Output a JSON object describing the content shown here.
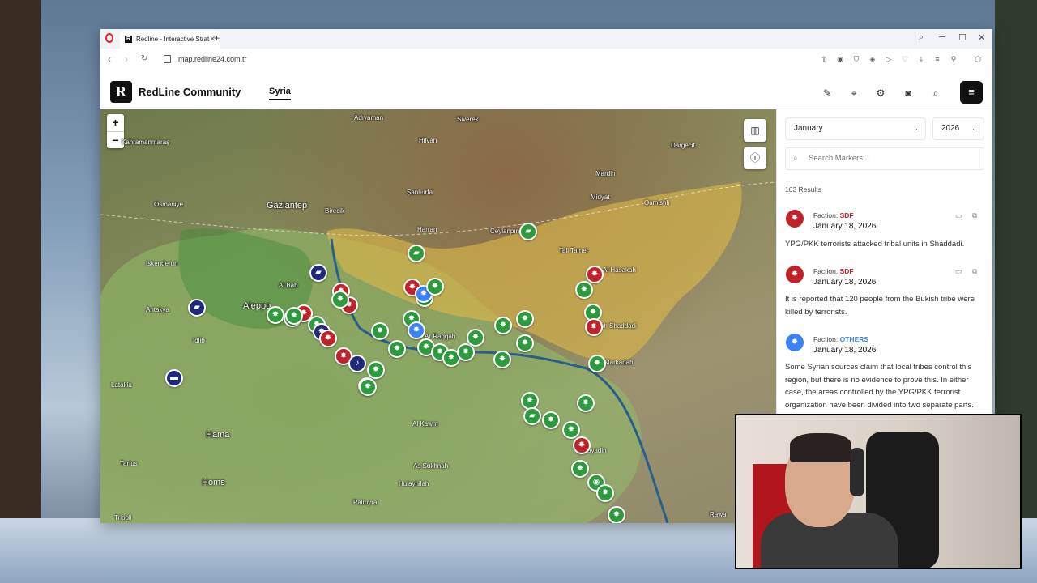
{
  "browser": {
    "tab_title": "Redline - Interactive Strat",
    "new_tab": "+",
    "url": "map.redline24.com.tr"
  },
  "header": {
    "logo": "R",
    "brand": "RedLine Community",
    "nav_tab": "Syria"
  },
  "map": {
    "zoom_in": "+",
    "zoom_out": "−",
    "cities": [
      {
        "name": "Adıyaman",
        "big": false
      },
      {
        "name": "Kahramanmaraş",
        "big": false
      },
      {
        "name": "Gaziantep",
        "big": true
      },
      {
        "name": "Şanlıurfa",
        "big": false
      },
      {
        "name": "Mardin",
        "big": false
      },
      {
        "name": "Osmaniye",
        "big": false
      },
      {
        "name": "Iskenderun",
        "big": false
      },
      {
        "name": "Antakya",
        "big": false
      },
      {
        "name": "Aleppo",
        "big": true
      },
      {
        "name": "Al Bab",
        "big": false
      },
      {
        "name": "Latakia",
        "big": false
      },
      {
        "name": "Hama",
        "big": true
      },
      {
        "name": "Homs",
        "big": true
      },
      {
        "name": "Tartus",
        "big": false
      },
      {
        "name": "Tripoli",
        "big": false
      },
      {
        "name": "Palmyra",
        "big": false
      },
      {
        "name": "Ar Raqqah",
        "big": false
      },
      {
        "name": "Harran",
        "big": false
      },
      {
        "name": "Ceylanpınar",
        "big": false
      },
      {
        "name": "Siverek",
        "big": false
      },
      {
        "name": "Hilvan",
        "big": false
      },
      {
        "name": "Birecik",
        "big": false
      },
      {
        "name": "Idlib",
        "big": false
      },
      {
        "name": "Al Kawm",
        "big": false
      },
      {
        "name": "As Sukhnah",
        "big": false
      },
      {
        "name": "Hulayhilah",
        "big": false
      },
      {
        "name": "Dargecit",
        "big": false
      },
      {
        "name": "Midyat",
        "big": false
      },
      {
        "name": "Qamishli",
        "big": false
      },
      {
        "name": "Al Hasakah",
        "big": false
      },
      {
        "name": "Tall Tamer",
        "big": false
      },
      {
        "name": "Ash Shaddadi",
        "big": false
      },
      {
        "name": "Markadah",
        "big": false
      },
      {
        "name": "Al Mayadin",
        "big": false
      },
      {
        "name": "Rawa",
        "big": false
      }
    ]
  },
  "sidebar": {
    "month": "January",
    "year": "2026",
    "search_placeholder": "Search Markers...",
    "results": "163 Results",
    "items": [
      {
        "faction_label": "Faction:",
        "faction": "SDF",
        "date": "January 18, 2026",
        "text": "YPG/PKK terrorists attacked tribal units in Shaddadi.",
        "color": "#c0222a"
      },
      {
        "faction_label": "Faction:",
        "faction": "SDF",
        "date": "January 18, 2026",
        "text": "It is reported that 120 people from the Bukish tribe were killed by terrorists.",
        "color": "#c0222a"
      },
      {
        "faction_label": "Faction:",
        "faction": "OTHERS",
        "date": "January 18, 2026",
        "text": "Some Syrian sources claim that local tribes control this region, but there is no evidence to prove this. In either case, the areas controlled by the YPG/PKK terrorist organization have been divided into two separate parts.",
        "color": "#3b82f6"
      }
    ]
  },
  "colors": {
    "sdf_zone": "#d9b54a",
    "gov_zone": "#8fbf6a",
    "sdf_accent": "#c0222a",
    "others_accent": "#3b82f6"
  }
}
